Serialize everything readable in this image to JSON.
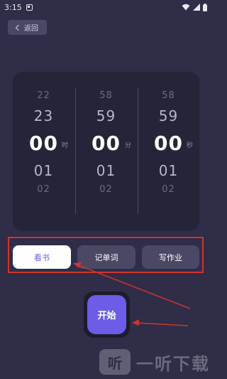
{
  "status_bar": {
    "time": "3:15"
  },
  "nav": {
    "back_label": "返回"
  },
  "picker": {
    "hours": {
      "rows": [
        "22",
        "23",
        "00",
        "01",
        "02"
      ],
      "unit": "时"
    },
    "minutes": {
      "rows": [
        "58",
        "59",
        "00",
        "01",
        "02"
      ],
      "unit": "分"
    },
    "seconds": {
      "rows": [
        "58",
        "59",
        "00",
        "01",
        "02"
      ],
      "unit": "秒"
    }
  },
  "tasks": [
    {
      "label": "看书",
      "selected": true
    },
    {
      "label": "记单词",
      "selected": false
    },
    {
      "label": "写作业",
      "selected": false
    }
  ],
  "start_label": "开始",
  "watermark": {
    "logo_char": "听",
    "text": "一听下载"
  },
  "colors": {
    "accent": "#6c5ce7",
    "annotation": "#d0342c",
    "background": "#2f2d47"
  }
}
